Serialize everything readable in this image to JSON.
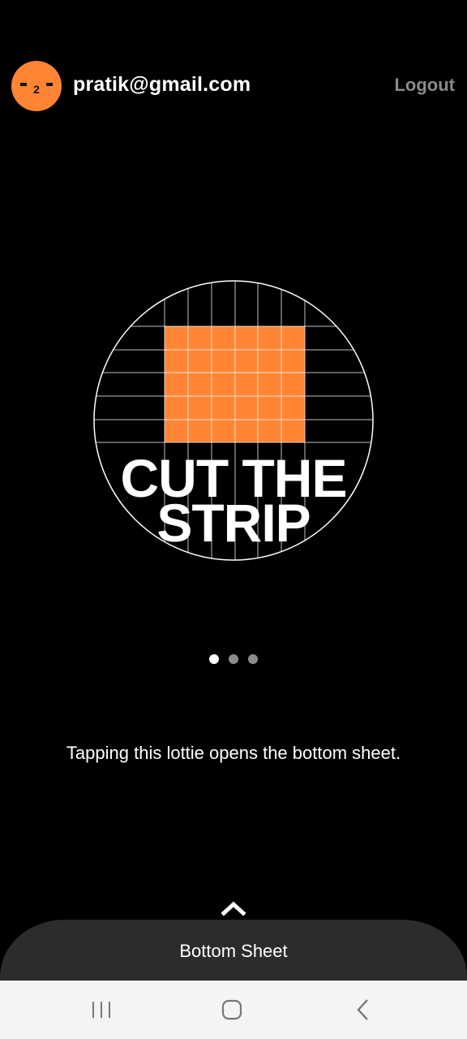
{
  "header": {
    "avatar_icon": "user-avatar-face-icon",
    "avatar_color": "#ff8535",
    "email": "pratik@gmail.com",
    "logout_label": "Logout"
  },
  "lottie": {
    "title_line1": "CUT THE",
    "title_line2": "STRIP",
    "accent_color": "#ff8535"
  },
  "pager": {
    "count": 3,
    "active_index": 0
  },
  "description": "Tapping this lottie opens the bottom sheet.",
  "bottom_sheet": {
    "handle_icon": "chevron-up-icon",
    "label": "Bottom Sheet",
    "background": "#2c2c2c"
  },
  "system_nav": {
    "recents_icon": "recents-icon",
    "home_icon": "home-icon",
    "back_icon": "back-icon"
  }
}
